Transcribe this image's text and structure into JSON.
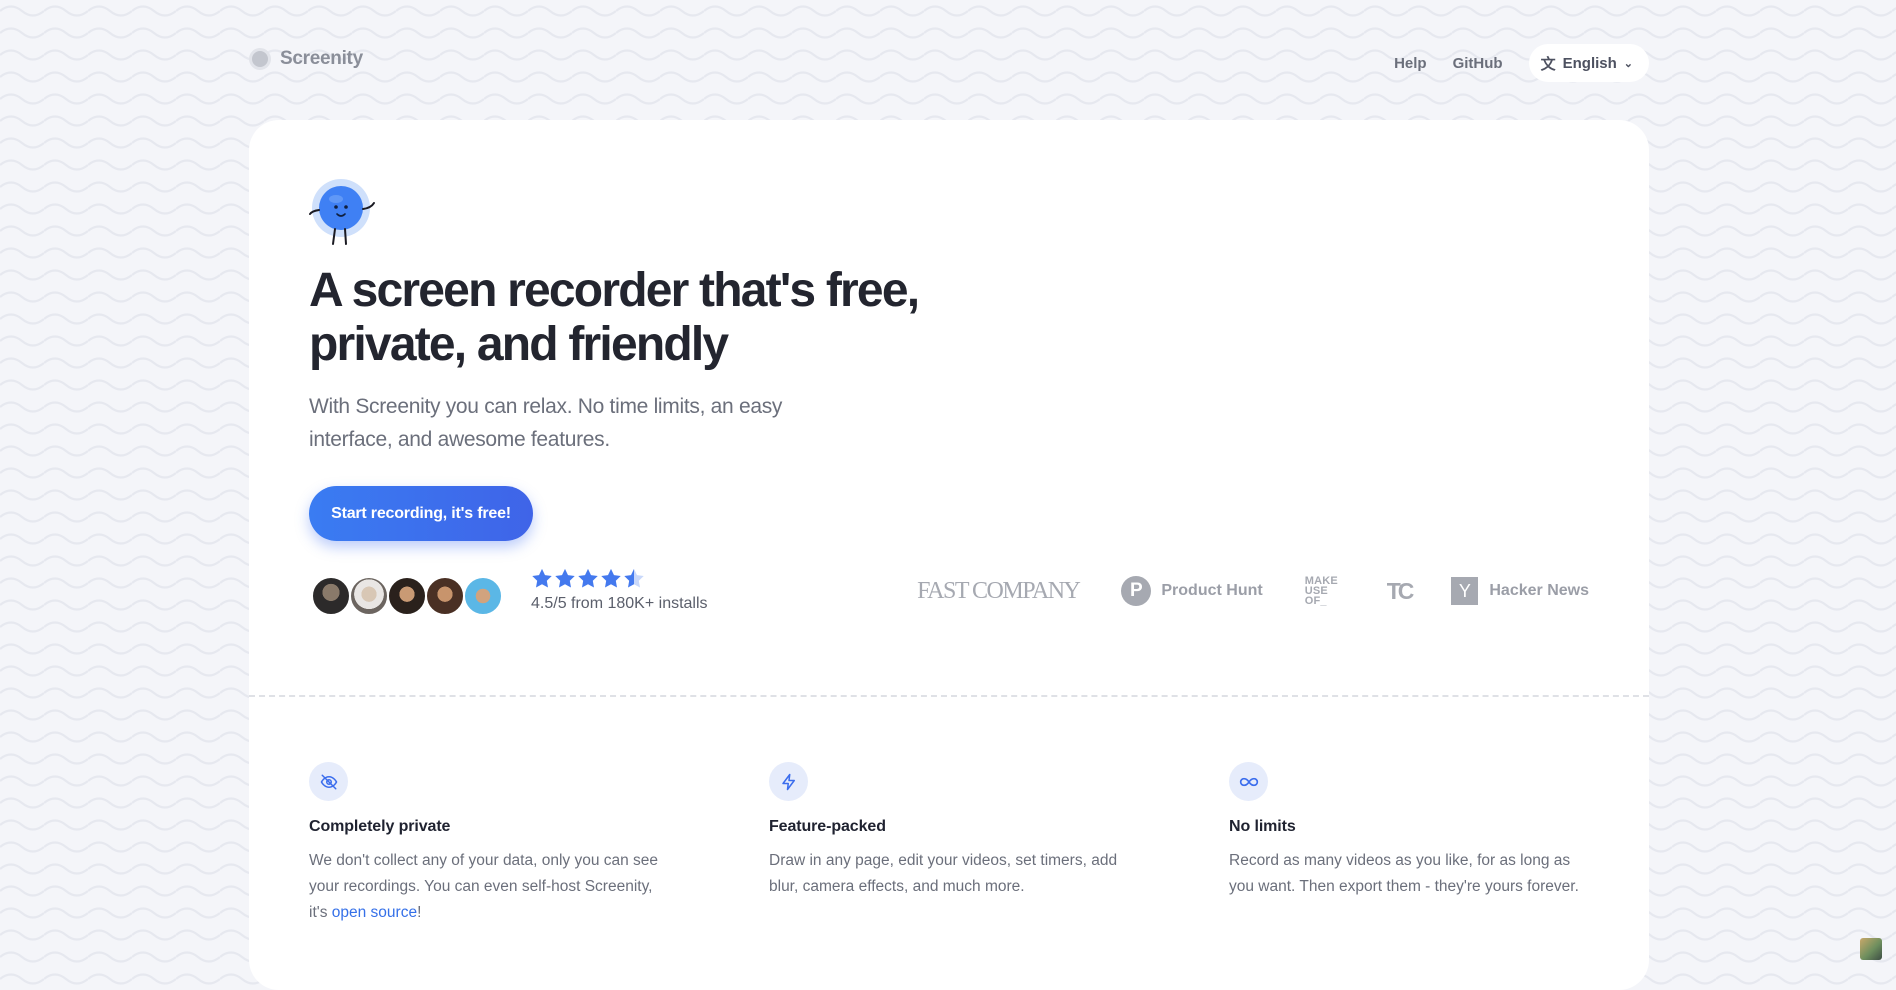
{
  "header": {
    "brand": "Screenity",
    "nav": {
      "help": "Help",
      "github": "GitHub"
    },
    "language": {
      "selected": "English",
      "icon": "translate-icon"
    }
  },
  "hero": {
    "title": "A screen recorder that's free, private, and friendly",
    "subtitle": "With Screenity you can relax. No time limits, an easy interface, and awesome features.",
    "cta": "Start recording, it's free!",
    "rating": {
      "value": 4.5,
      "max": 5,
      "text": "4.5/5 from 180K+ installs"
    }
  },
  "press": {
    "fast_company": "FAST COMPANY",
    "product_hunt_initial": "P",
    "product_hunt": "Product Hunt",
    "makeuseof": "MAKE USE OF_",
    "techcrunch": "TC",
    "hacker_news_initial": "Y",
    "hacker_news": "Hacker News"
  },
  "features": [
    {
      "icon": "eye-off-icon",
      "title": "Completely private",
      "body": "We don't collect any of your data, only you can see your recordings. You can even self-host Screenity, it's ",
      "link": "open source",
      "after": "!"
    },
    {
      "icon": "lightning-icon",
      "title": "Feature-packed",
      "body": "Draw in any page, edit your videos, set timers, add blur, camera effects, and much more."
    },
    {
      "icon": "infinity-icon",
      "title": "No limits",
      "body": "Record as many videos as you like, for as long as you want. Then export them - they're yours forever."
    }
  ],
  "colors": {
    "accent": "#3b6ded",
    "cta_start": "#3a7cf2",
    "cta_end": "#3f64e8",
    "text": "#1f2230",
    "muted": "#6b6f7b"
  }
}
